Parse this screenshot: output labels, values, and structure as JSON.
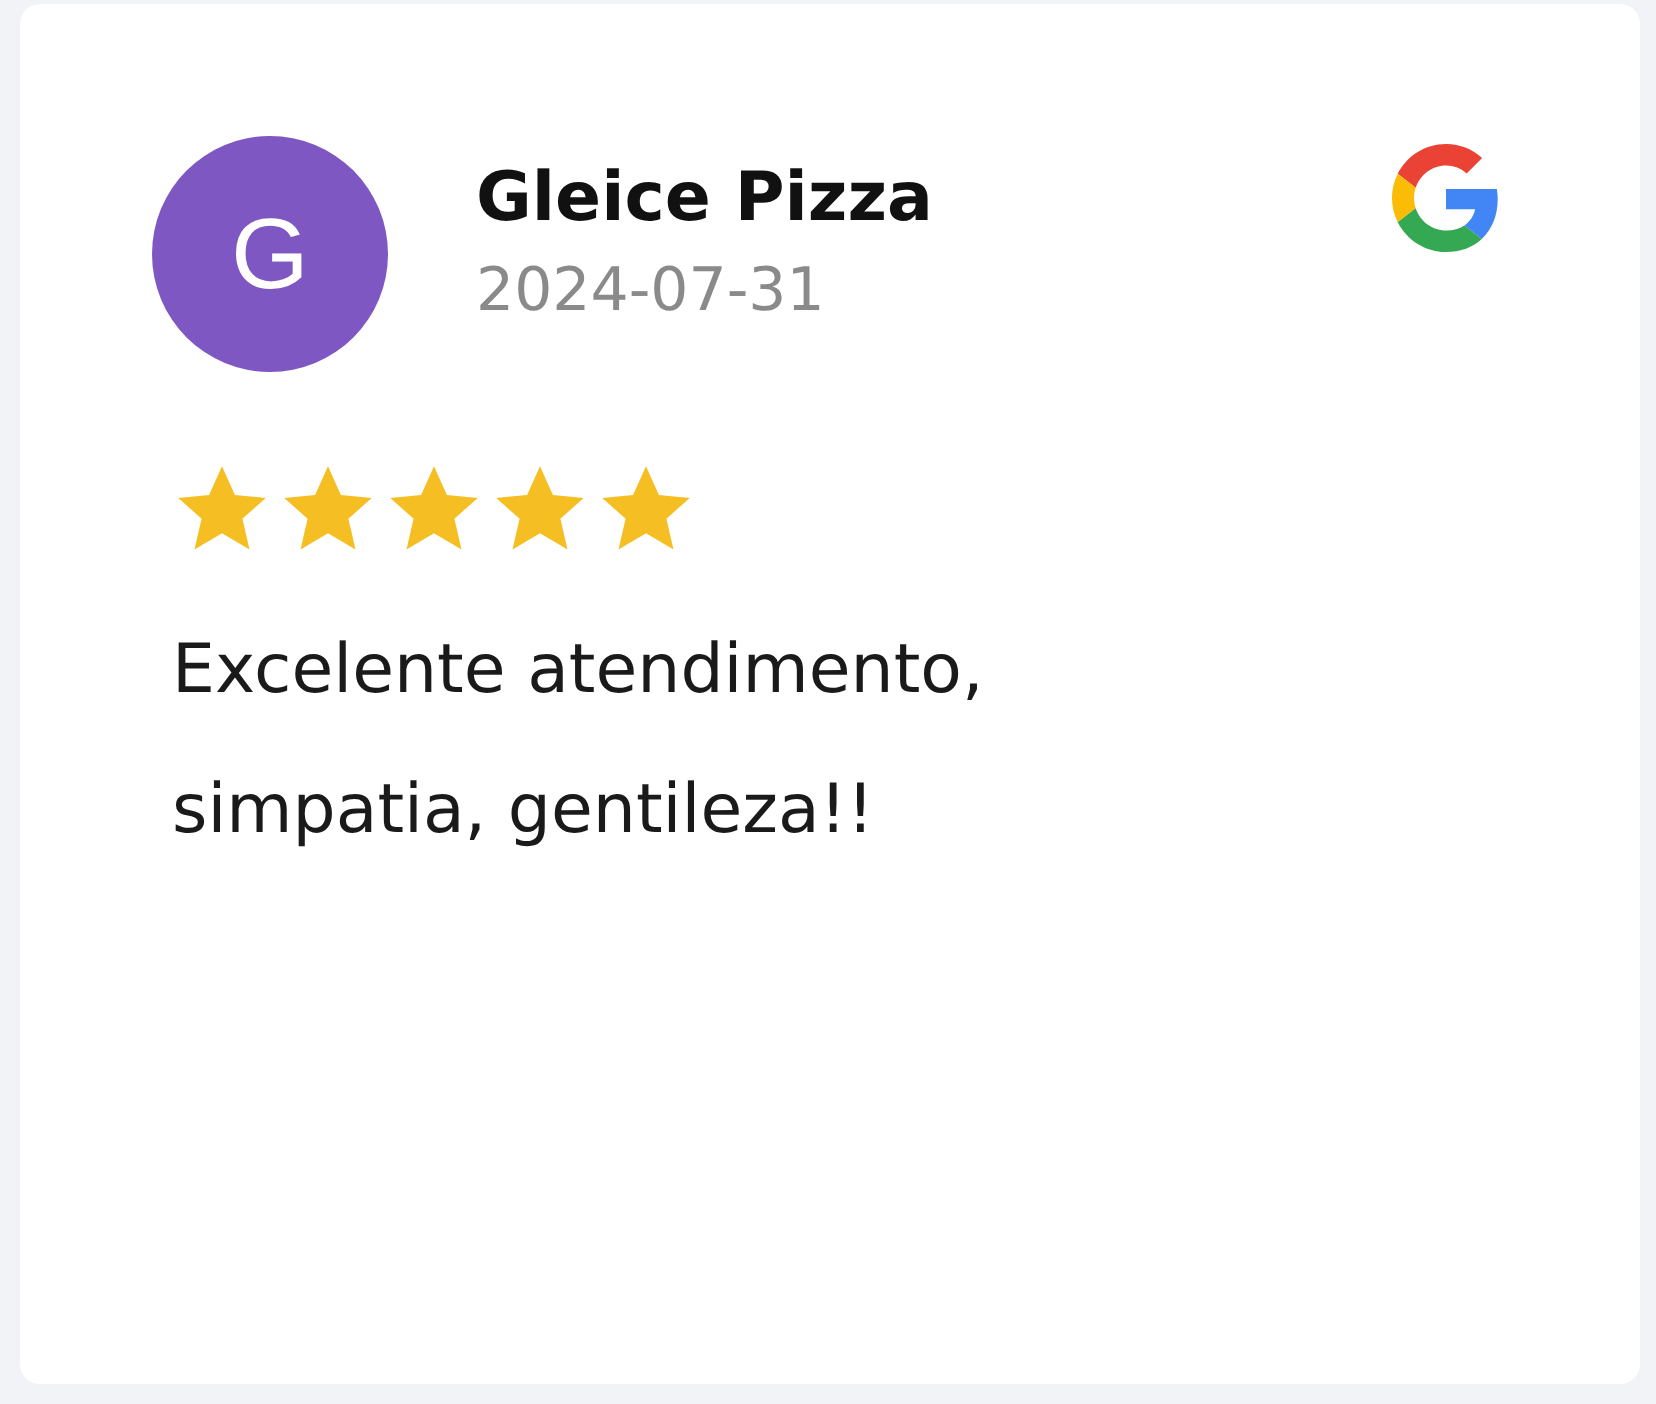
{
  "review": {
    "avatar_letter": "G",
    "author": "Gleice Pizza",
    "date": "2024-07-31",
    "stars": 5,
    "text": "Excelente atendimento, simpatia, gentileza!!"
  }
}
